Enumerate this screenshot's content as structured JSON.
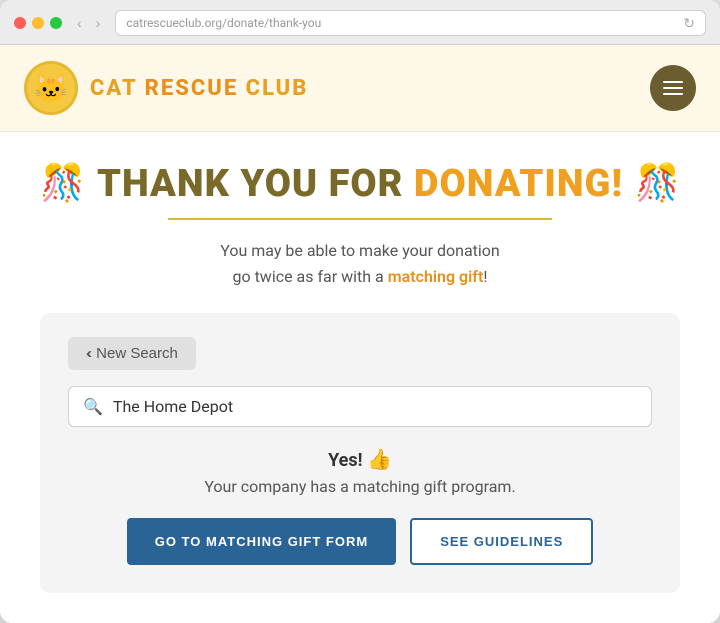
{
  "browser": {
    "address": "catrescueclub.org/donate/thank-you"
  },
  "header": {
    "logo_emoji": "😺",
    "title_part1": "CAT ",
    "title_part2": "RESCUE",
    "title_part3": " CLUB",
    "menu_label": "Menu"
  },
  "hero": {
    "heading_part1": "THANK YOU FOR ",
    "heading_part2": "DONATING!",
    "confetti_left": "🎉",
    "confetti_right": "🎉",
    "subtitle_part1": "You may be able to make your donation\ngo twice as far with a ",
    "matching_link_text": "matching gift",
    "subtitle_part2": "!"
  },
  "search_card": {
    "new_search_label": "‹ New Search",
    "search_placeholder": "The Home Depot",
    "search_icon": "🔍",
    "result_yes": "Yes!",
    "result_thumbs": "👍",
    "result_description": "Your company has a matching gift program.",
    "btn_primary_label": "GO TO MATCHING GIFT FORM",
    "btn_secondary_label": "SEE GUIDELINES"
  }
}
